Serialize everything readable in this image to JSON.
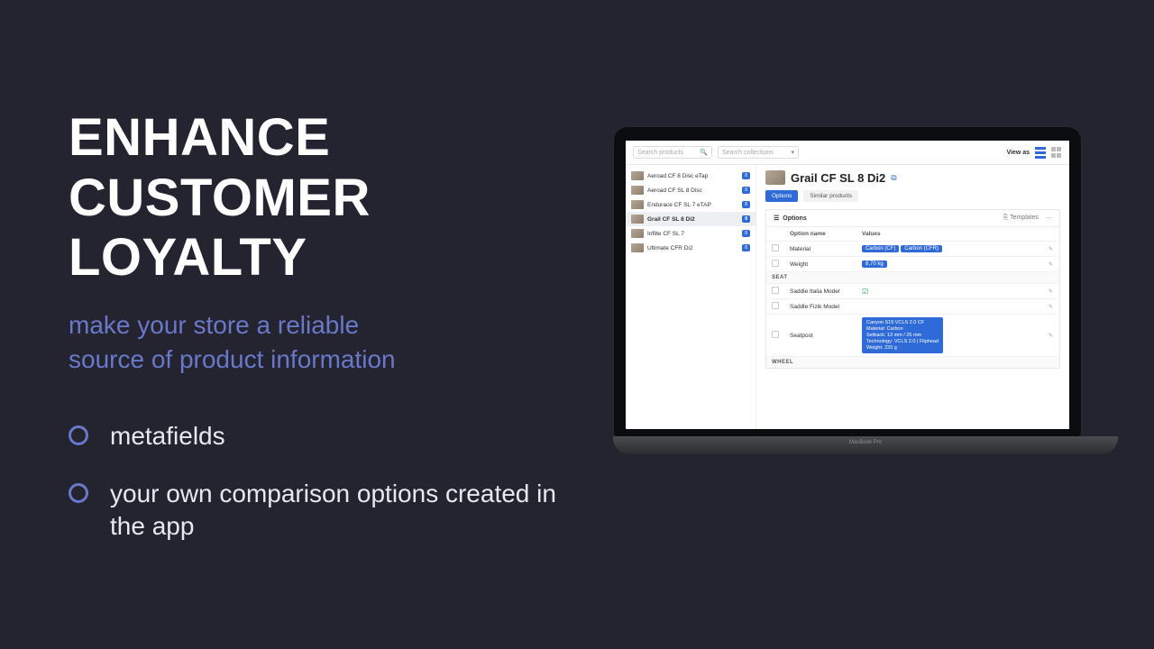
{
  "left": {
    "headline_l1": "ENHANCE",
    "headline_l2": "CUSTOMER",
    "headline_l3": "LOYALTY",
    "sub_l1": "make your store a reliable",
    "sub_l2": "source of product information",
    "bullets": [
      "metafields",
      "your own comparison options created in the app"
    ]
  },
  "laptop_label": "MacBook Pro",
  "topbar": {
    "search_products_ph": "Search products",
    "search_collections_ph": "Search collections",
    "view_as": "View as"
  },
  "sidebar": {
    "items": [
      {
        "label": "Aeroad CF 8 Disc eTap",
        "count": "8"
      },
      {
        "label": "Aeroad CF SL 8 Disc",
        "count": "8"
      },
      {
        "label": "Endurace CF SL 7 eTAP",
        "count": "8"
      },
      {
        "label": "Grail CF SL 8 Di2",
        "count": "8",
        "active": true
      },
      {
        "label": "Inflite CF SL 7",
        "count": "8"
      },
      {
        "label": "Ultimate CFR Di2",
        "count": "8"
      }
    ]
  },
  "product": {
    "title": "Grail CF SL 8 Di2",
    "tabs": {
      "options": "Options",
      "similar": "Similar products"
    }
  },
  "panel": {
    "title": "Options",
    "templates": "Templates",
    "headers": {
      "name": "Option name",
      "values": "Values"
    },
    "rows": [
      {
        "name": "Material",
        "chips": [
          "Carbon (CF)",
          "Carbon (CFR)"
        ]
      },
      {
        "name": "Weight",
        "chips": [
          "8,70 kg"
        ]
      }
    ],
    "section1": "SEAT",
    "rows2": [
      {
        "name": "Saddle Italia Model",
        "check": true
      },
      {
        "name": "Saddle Fizik Model"
      },
      {
        "name": "Seatpost",
        "big": "Canyon S15 VCLS 2.0 CF\nMaterial: Carbon\nSetback: 13 mm / 25 mm\nTechnology: VCLS 2.0 | Fliphead\nWeight: 220 g"
      }
    ],
    "section2": "WHEEL"
  }
}
